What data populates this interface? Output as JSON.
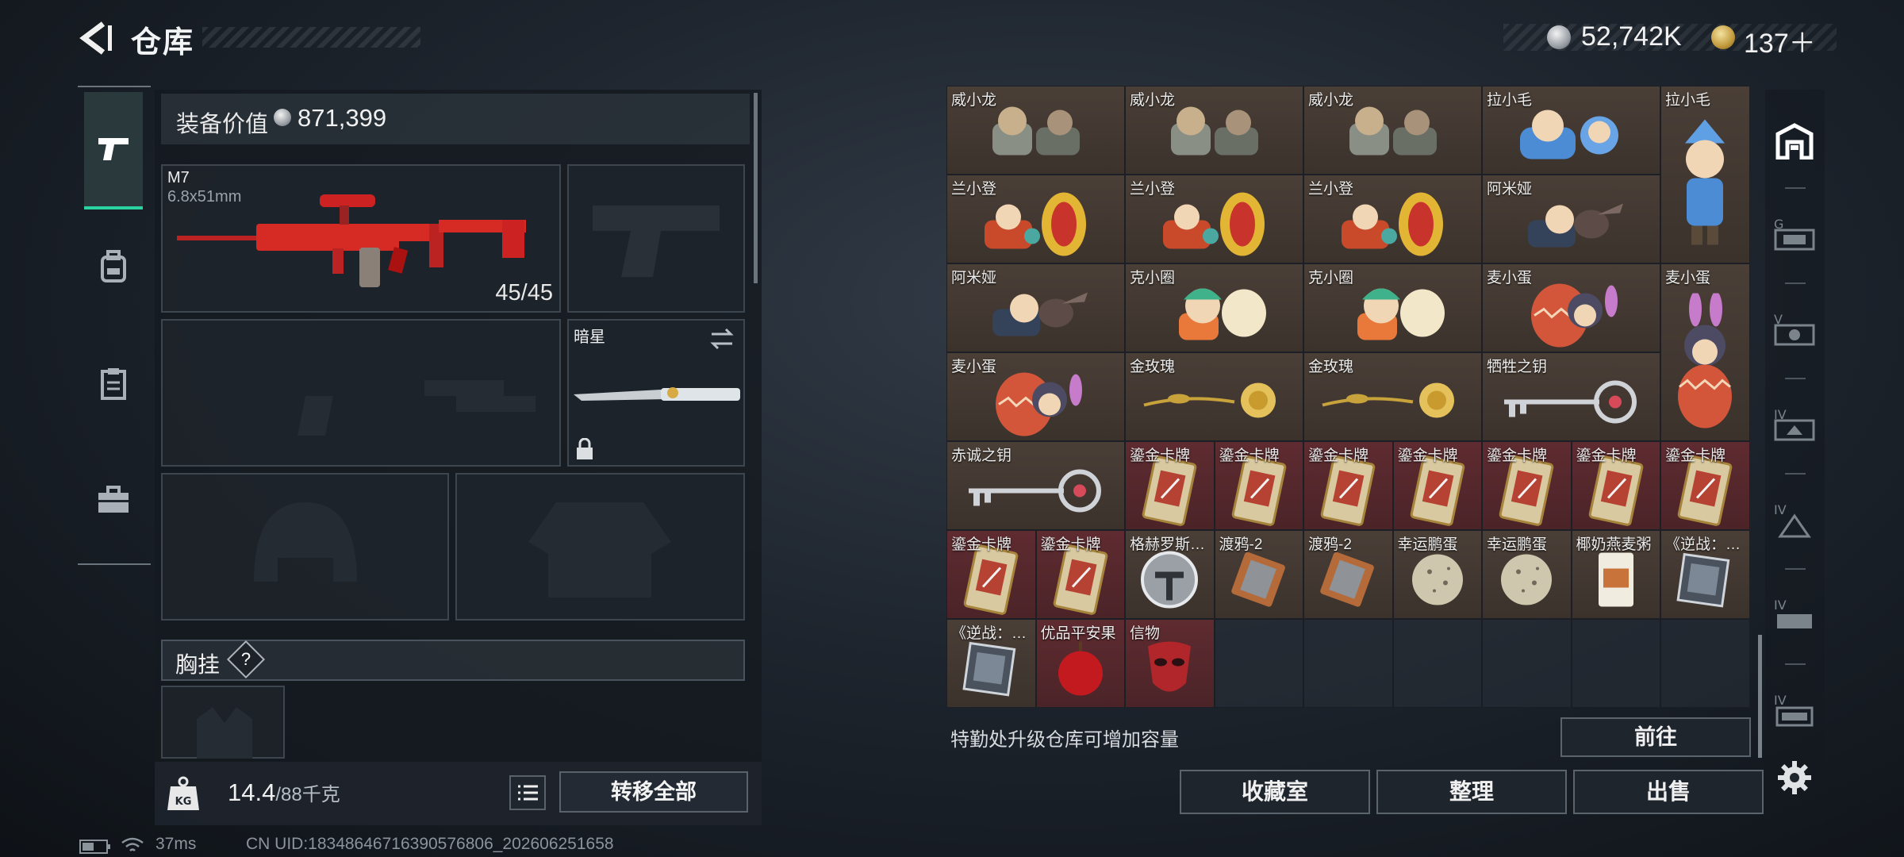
{
  "header": {
    "title": "仓库",
    "back_icon": "back-arrow-icon"
  },
  "currency": {
    "silver": "52,742K",
    "gold": "137＋"
  },
  "left_nav": [
    {
      "name": "weapons",
      "icon": "pistol-icon",
      "active": true
    },
    {
      "name": "backpack",
      "icon": "backpack-icon",
      "active": false
    },
    {
      "name": "clipboard",
      "icon": "clipboard-icon",
      "active": false
    },
    {
      "name": "toolbox",
      "icon": "briefcase-icon",
      "active": false
    }
  ],
  "loadout": {
    "value_label": "装备价值",
    "value": "871,399",
    "primary": {
      "name": "M7",
      "caliber": "6.8x51mm",
      "ammo": "45/45"
    },
    "melee": {
      "name": "暗星"
    },
    "chest_label": "胸挂",
    "help": "?"
  },
  "footer": {
    "weight": "14.4",
    "weight_cap": "/88千克",
    "transfer_all": "转移全部"
  },
  "stash": {
    "items": [
      {
        "label": "威小龙",
        "type": "doll-gray"
      },
      {
        "label": "威小龙",
        "type": "doll-gray"
      },
      {
        "label": "威小龙",
        "type": "doll-gray"
      },
      {
        "label": "拉小毛",
        "type": "doll-blue"
      },
      {
        "label": "拉小毛",
        "type": "doll-blue-tall"
      },
      {
        "label": "兰小登",
        "type": "doll-sombrero"
      },
      {
        "label": "兰小登",
        "type": "doll-sombrero"
      },
      {
        "label": "兰小登",
        "type": "doll-sombrero"
      },
      {
        "label": "阿米娅",
        "type": "doll-bunny"
      },
      {
        "label": "阿米娅",
        "type": "doll-bunny"
      },
      {
        "label": "克小圈",
        "type": "doll-cap"
      },
      {
        "label": "克小圈",
        "type": "doll-cap"
      },
      {
        "label": "麦小蛋",
        "type": "doll-egg"
      },
      {
        "label": "麦小蛋",
        "type": "doll-egg-tall"
      },
      {
        "label": "麦小蛋",
        "type": "doll-egg"
      },
      {
        "label": "金玫瑰",
        "type": "gold-rose"
      },
      {
        "label": "金玫瑰",
        "type": "gold-rose"
      },
      {
        "label": "牺牲之钥",
        "type": "key"
      },
      {
        "label": "赤诚之钥",
        "type": "key"
      },
      {
        "label": "鎏金卡牌",
        "type": "card"
      },
      {
        "label": "鎏金卡牌",
        "type": "card"
      },
      {
        "label": "鎏金卡牌",
        "type": "card"
      },
      {
        "label": "鎏金卡牌",
        "type": "card"
      },
      {
        "label": "鎏金卡牌",
        "type": "card"
      },
      {
        "label": "鎏金卡牌",
        "type": "card"
      },
      {
        "label": "鎏金卡牌",
        "type": "card"
      },
      {
        "label": "鎏金卡牌",
        "type": "card"
      },
      {
        "label": "鎏金卡牌",
        "type": "card"
      },
      {
        "label": "格赫罗斯…",
        "type": "disc"
      },
      {
        "label": "渡鸦-2",
        "type": "chip"
      },
      {
        "label": "渡鸦-2",
        "type": "chip"
      },
      {
        "label": "幸运鹏蛋",
        "type": "egg"
      },
      {
        "label": "幸运鹏蛋",
        "type": "egg"
      },
      {
        "label": "椰奶燕麦粥",
        "type": "pouch"
      },
      {
        "label": "《逆战：…",
        "type": "book"
      },
      {
        "label": "《逆战：…",
        "type": "book"
      },
      {
        "label": "优品平安果",
        "type": "apple"
      },
      {
        "label": "信物",
        "type": "mask"
      }
    ],
    "upgrade_text": "特勤处升级仓库可增加容量",
    "goto": "前往",
    "collection": "收藏室",
    "organize": "整理",
    "sell": "出售"
  },
  "right_nav": [
    "storage-icon",
    "tier-6-icon",
    "tier-5-icon",
    "tier-4-icon",
    "tier-4-icon",
    "tier-4-icon",
    "tier-4-icon",
    "settings-icon"
  ],
  "status": {
    "ping": "37ms",
    "uid": "CN UID:18348646716390576806_202606251658"
  }
}
